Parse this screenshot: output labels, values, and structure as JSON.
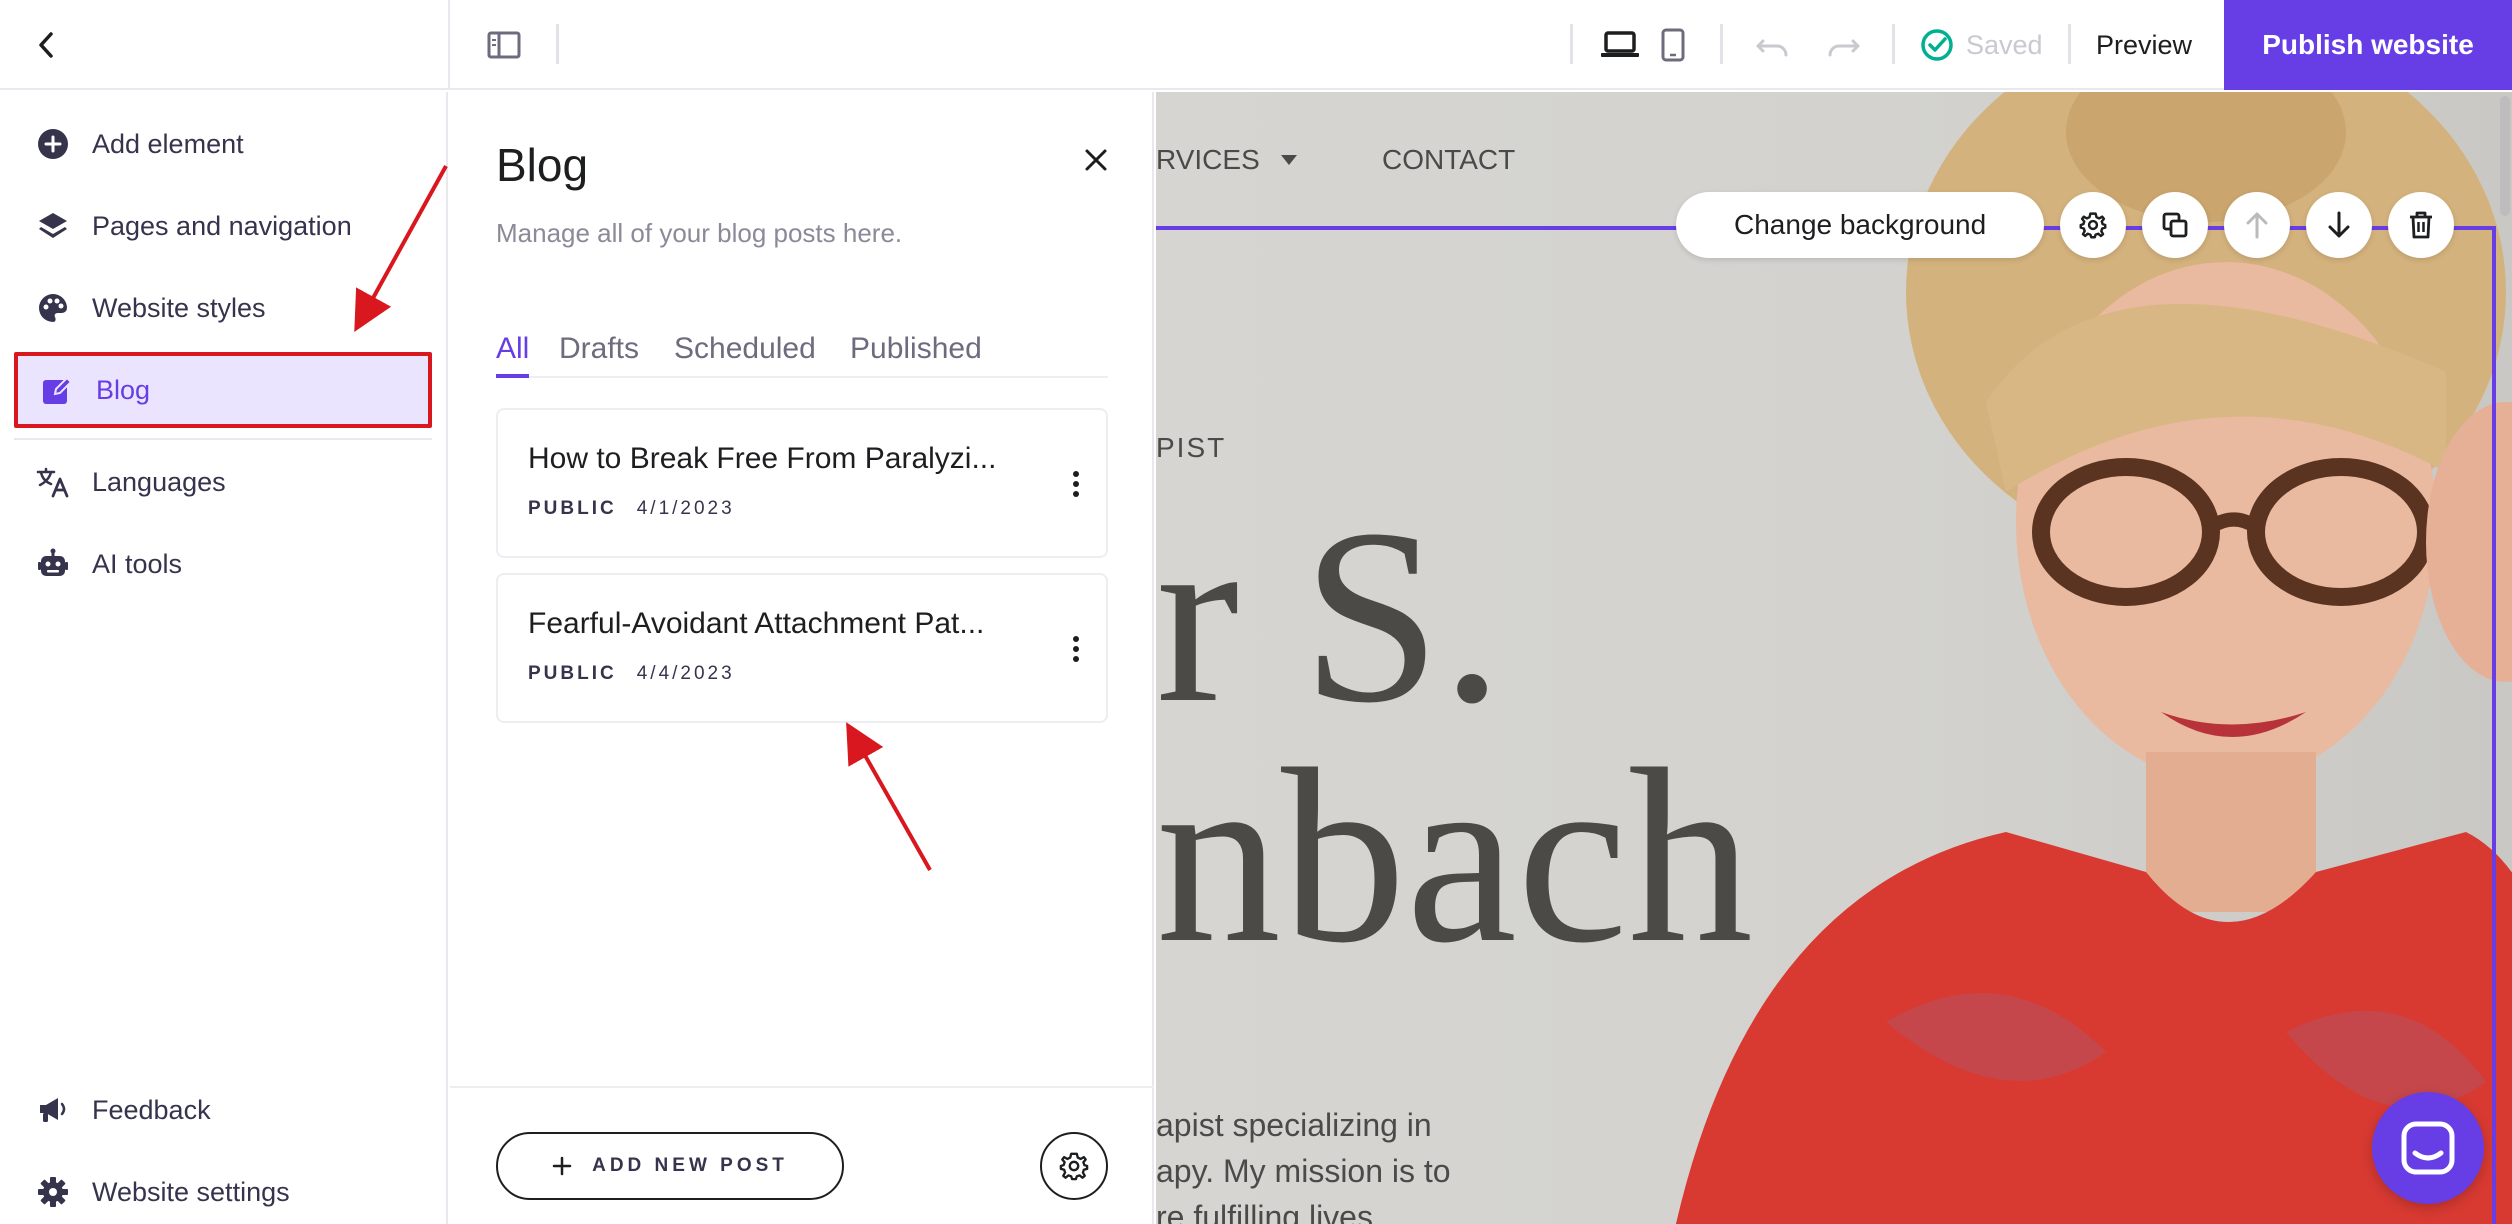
{
  "topbar": {
    "saved_label": "Saved",
    "preview_label": "Preview",
    "publish_label": "Publish website"
  },
  "sidebar": {
    "items": [
      {
        "label": "Add element",
        "icon": "plus-circle-icon"
      },
      {
        "label": "Pages and navigation",
        "icon": "layers-icon"
      },
      {
        "label": "Website styles",
        "icon": "palette-icon"
      },
      {
        "label": "Blog",
        "icon": "edit-icon",
        "active": true
      },
      {
        "label": "Languages",
        "icon": "translate-icon"
      },
      {
        "label": "AI tools",
        "icon": "robot-icon"
      }
    ],
    "bottom": [
      {
        "label": "Feedback",
        "icon": "megaphone-icon"
      },
      {
        "label": "Website settings",
        "icon": "gear-icon"
      }
    ]
  },
  "blog": {
    "title": "Blog",
    "subtitle": "Manage all of your blog posts here.",
    "tabs": [
      "All",
      "Drafts",
      "Scheduled",
      "Published"
    ],
    "active_tab": "All",
    "posts": [
      {
        "title": "How to Break Free From Paralyzi...",
        "status": "PUBLIC",
        "date": "4/1/2023"
      },
      {
        "title": "Fearful-Avoidant Attachment Pat...",
        "status": "PUBLIC",
        "date": "4/4/2023"
      }
    ],
    "add_post_label": "ADD NEW POST"
  },
  "canvas": {
    "nav_services": "RVICES",
    "nav_contact": "CONTACT",
    "change_background": "Change background",
    "hero_kicker": "PIST",
    "hero_line1": "r S.",
    "hero_line2": "nbach",
    "hero_body": [
      "apist specializing in",
      "apy. My mission is to",
      "re fulfilling lives."
    ]
  },
  "colors": {
    "accent": "#673de6",
    "active_bg": "#ebe4ff",
    "annotation_red": "#d8171f",
    "saved_green": "#00b090"
  }
}
